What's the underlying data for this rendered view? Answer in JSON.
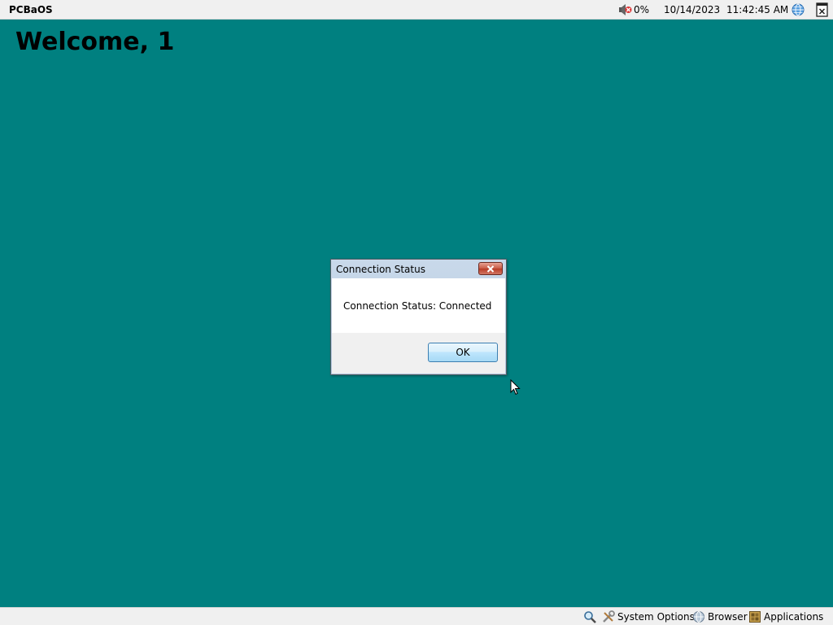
{
  "topbar": {
    "brand": "PCBaOS",
    "volume_icon": "muted-speaker-icon",
    "volume_level": "0%",
    "date": "10/14/2023",
    "time": "11:42:45 AM",
    "network_icon": "globe-icon",
    "exit_icon": "window-close-icon"
  },
  "desktop": {
    "welcome": "Welcome, 1",
    "background_color": "#008080"
  },
  "dialog": {
    "title": "Connection Status",
    "message": "Connection Status: Connected",
    "ok_label": "OK",
    "close_icon": "close-icon"
  },
  "bottombar": {
    "search_icon": "search-icon",
    "system_options_label": "System Options",
    "system_options_icon": "tools-icon",
    "browser_label": "Browser",
    "browser_icon": "globe-icon",
    "applications_label": "Applications",
    "applications_icon": "applications-icon"
  }
}
